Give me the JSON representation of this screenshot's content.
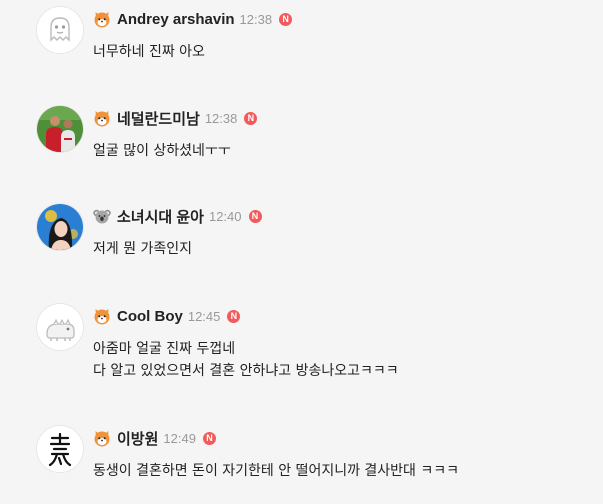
{
  "comments": [
    {
      "avatar": "ghost-character-icon",
      "level_icon": "shiba-dog-icon",
      "nickname": "Andrey arshavin",
      "time": "12:38",
      "new_badge": "N",
      "lines": [
        "너무하네 진짜 아오"
      ]
    },
    {
      "avatar": "soccer-players-photo",
      "level_icon": "shiba-dog-icon",
      "nickname": "네덜란드미남",
      "time": "12:38",
      "new_badge": "N",
      "lines": [
        "얼굴 많이 상하셨네ㅜㅜ"
      ]
    },
    {
      "avatar": "girl-portrait-photo",
      "level_icon": "koala-icon",
      "nickname": "소녀시대 윤아",
      "time": "12:40",
      "new_badge": "N",
      "lines": [
        "저게 뭔 가족인지"
      ]
    },
    {
      "avatar": "dinosaur-character-icon",
      "level_icon": "shiba-dog-icon",
      "nickname": "Cool Boy",
      "time": "12:45",
      "new_badge": "N",
      "lines": [
        "아줌마 얼굴 진짜 두껍네",
        "다 알고 있었으면서 결혼 안하냐고 방송나오고ㅋㅋㅋ"
      ]
    },
    {
      "avatar": "calligraphy-character-icon",
      "level_icon": "shiba-dog-icon",
      "nickname": "이방원",
      "time": "12:49",
      "new_badge": "N",
      "lines": [
        "동생이 결혼하면 돈이 자기한테 안 떨어지니까 결사반대 ㅋㅋㅋ"
      ]
    }
  ]
}
